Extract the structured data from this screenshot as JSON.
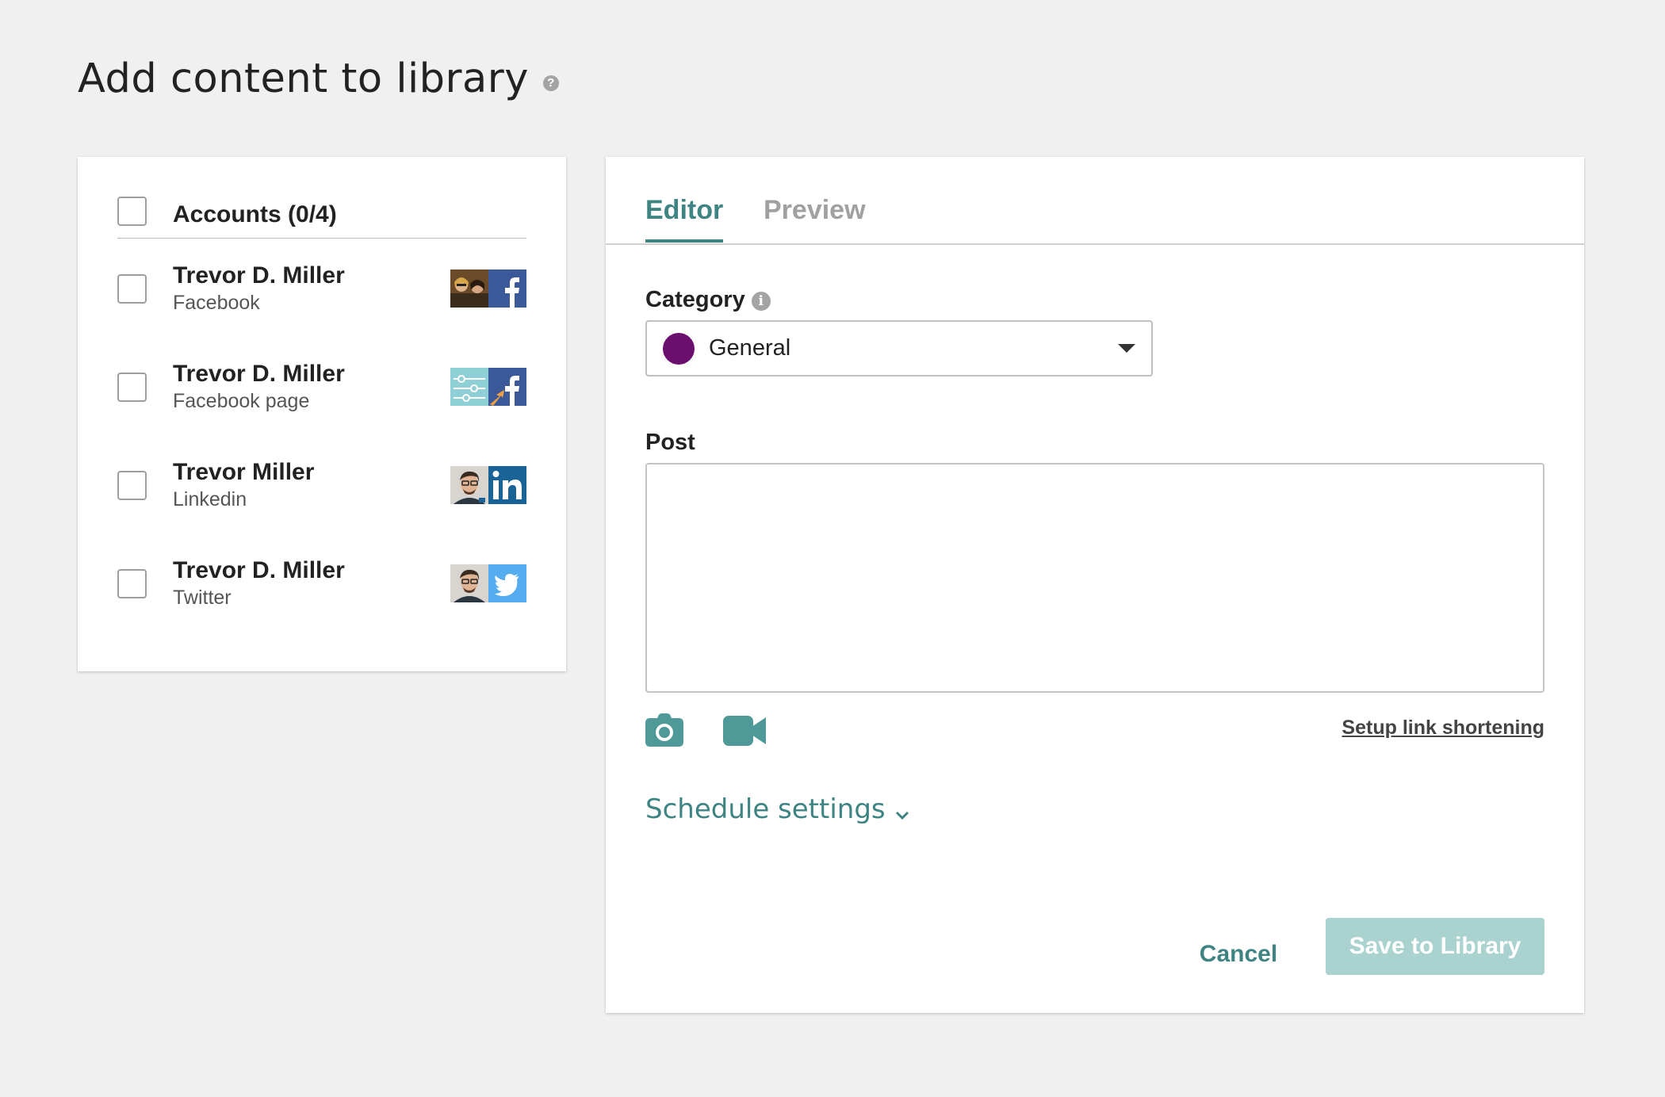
{
  "page": {
    "title": "Add content to library",
    "help_glyph": "?"
  },
  "accounts": {
    "header_label": "Accounts (0/4)",
    "items": [
      {
        "name": "Trevor D. Miller",
        "type": "Facebook",
        "network": "facebook-icon",
        "network_color": "#3b5998",
        "avatar": "group-photo-avatar"
      },
      {
        "name": "Trevor D. Miller",
        "type": "Facebook page",
        "network": "facebook-icon",
        "network_color": "#3b5998",
        "avatar": "page-logo-avatar"
      },
      {
        "name": "Trevor Miller",
        "type": "Linkedin",
        "network": "linkedin-icon",
        "network_color": "#1a6396",
        "avatar": "person-avatar"
      },
      {
        "name": "Trevor D. Miller",
        "type": "Twitter",
        "network": "twitter-icon",
        "network_color": "#55acee",
        "avatar": "person-avatar"
      }
    ]
  },
  "editor": {
    "tabs": [
      {
        "label": "Editor",
        "active": true
      },
      {
        "label": "Preview",
        "active": false
      }
    ],
    "category": {
      "label": "Category",
      "info_glyph": "i",
      "selected": "General",
      "color": "#6b0f6e"
    },
    "post": {
      "label": "Post",
      "value": ""
    },
    "link_shortening": "Setup link shortening",
    "schedule_settings": "Schedule settings",
    "cancel_label": "Cancel",
    "save_label": "Save to Library"
  },
  "colors": {
    "accent": "#3e8482",
    "save_disabled": "#aad2cf",
    "background": "#f0f0f0"
  }
}
